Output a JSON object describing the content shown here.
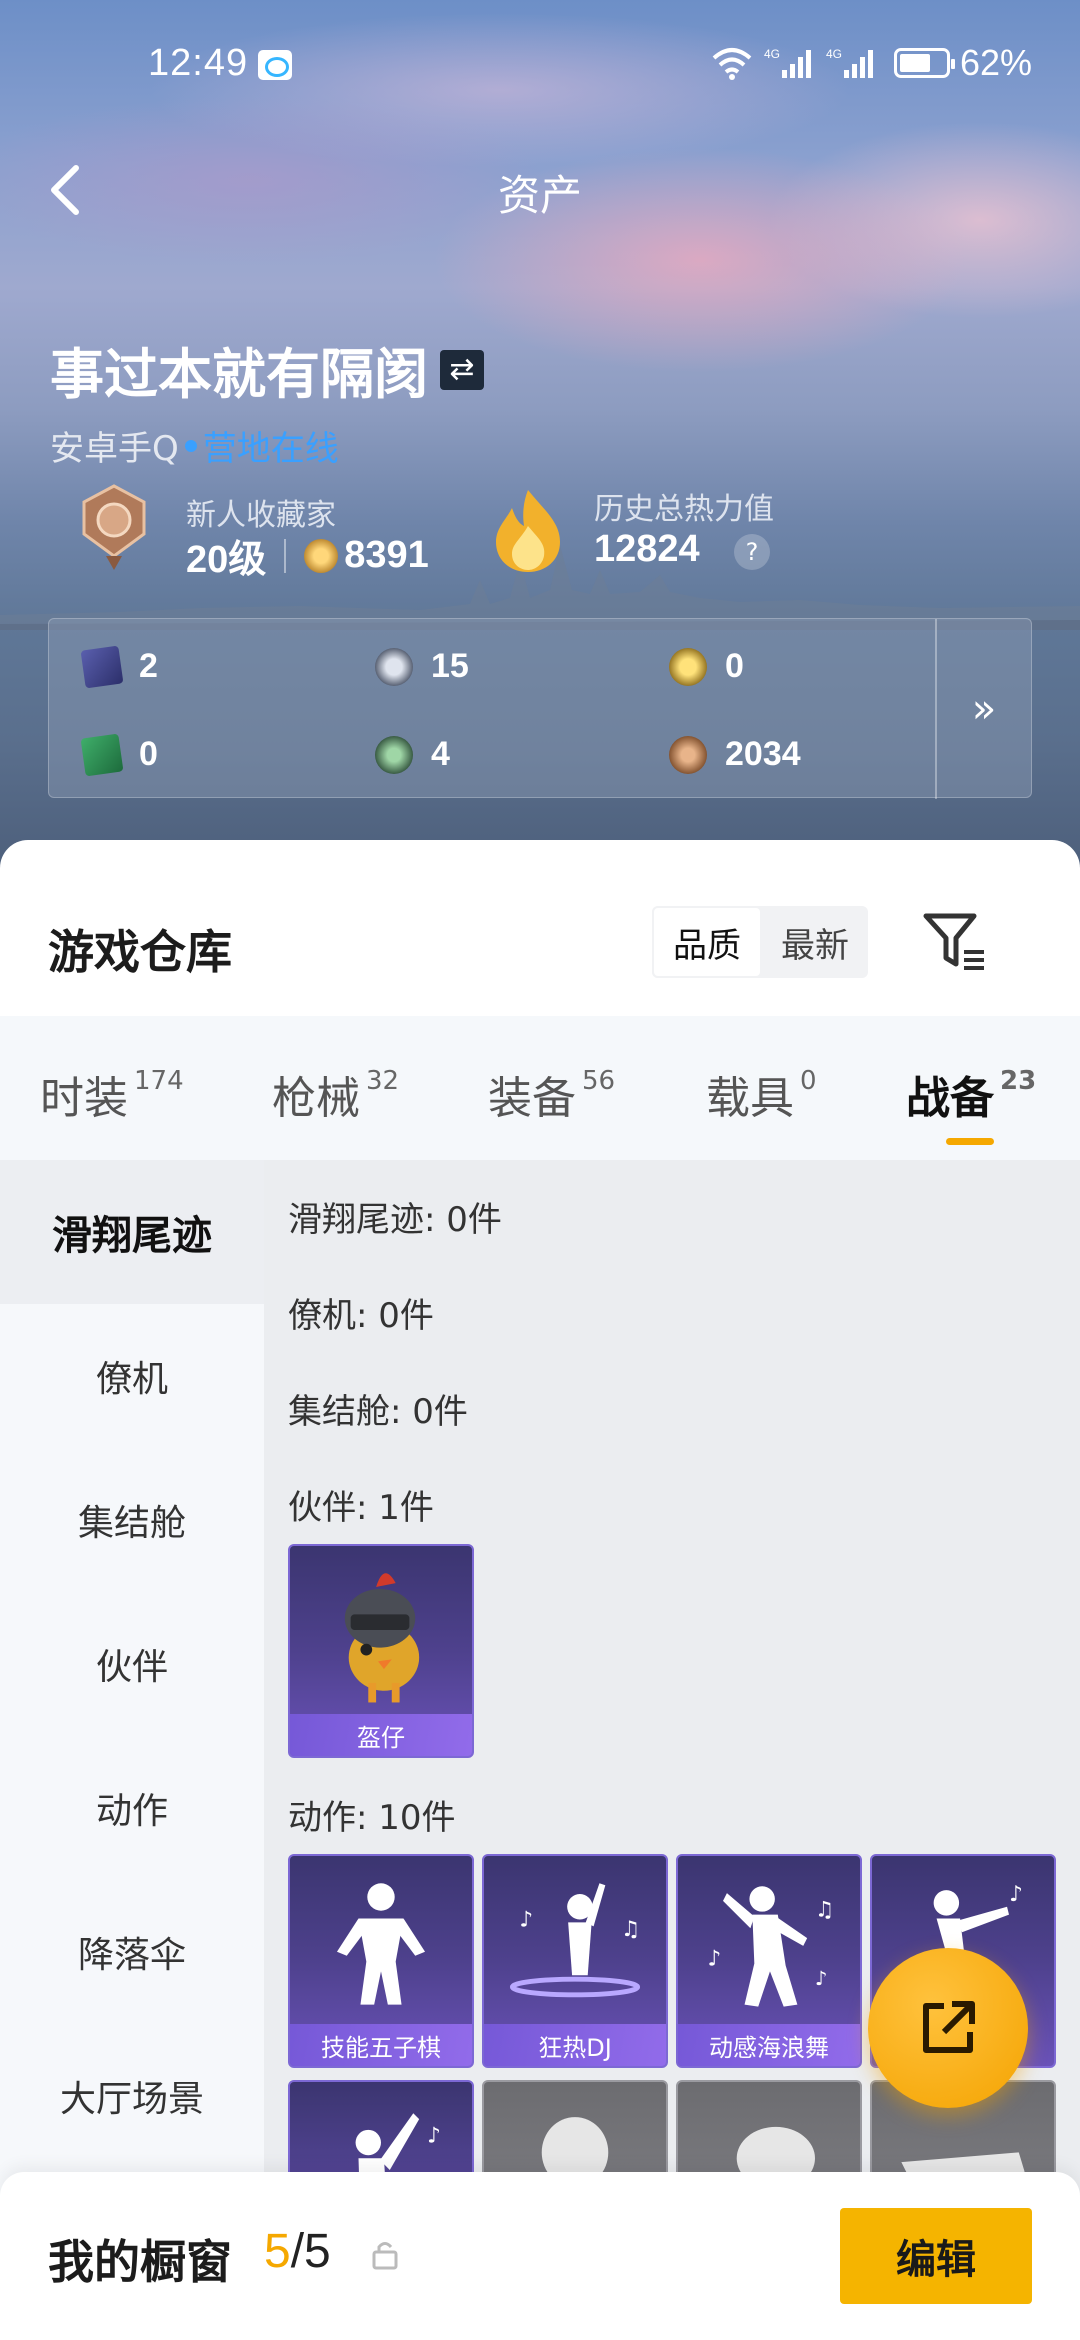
{
  "status_bar": {
    "time": "12:49",
    "network1": "4G",
    "network2": "4G",
    "battery": "62%"
  },
  "nav": {
    "title": "资产",
    "back_icon": "chevron-left-icon"
  },
  "profile": {
    "username": "事过本就有隔阂",
    "platform": "安卓手Q",
    "online_status": "营地在线"
  },
  "stats": {
    "rank_title": "新人收藏家",
    "level": "20级",
    "coins": "8391",
    "heat_title": "历史总热力值",
    "heat_value": "12824",
    "help": "?"
  },
  "currencies": [
    {
      "name": "card-currency",
      "value": "2"
    },
    {
      "name": "silver-coin",
      "value": "15"
    },
    {
      "name": "gold-coin",
      "value": "0"
    },
    {
      "name": "green-ticket",
      "value": "0"
    },
    {
      "name": "gem",
      "value": "4"
    },
    {
      "name": "bronze-coin",
      "value": "2034"
    }
  ],
  "currency_more": "»",
  "warehouse": {
    "title": "游戏仓库",
    "sort_options": [
      "品质",
      "最新"
    ],
    "sort_active": "品质"
  },
  "tabs": [
    {
      "label": "时装",
      "count": "174"
    },
    {
      "label": "枪械",
      "count": "32"
    },
    {
      "label": "装备",
      "count": "56"
    },
    {
      "label": "载具",
      "count": "0"
    },
    {
      "label": "战备",
      "count": "23"
    }
  ],
  "sidebar": [
    "滑翔尾迹",
    "僚机",
    "集结舱",
    "伙伴",
    "动作",
    "降落伞",
    "大厅场景"
  ],
  "sections": {
    "glide": "滑翔尾迹: 0件",
    "wingman": "僚机: 0件",
    "pod": "集结舱: 0件",
    "partner": "伙伴: 1件",
    "emote": "动作: 10件"
  },
  "partner_items": [
    "盔仔"
  ],
  "emote_items": [
    "技能五子棋",
    "狂热DJ",
    "动感海浪舞"
  ],
  "bottom": {
    "label": "我的橱窗",
    "current": "5",
    "total": "/5",
    "edit": "编辑"
  },
  "colors": {
    "accent": "#f5a800",
    "online": "#3aa0ff",
    "card_purple": "#4e418d"
  }
}
